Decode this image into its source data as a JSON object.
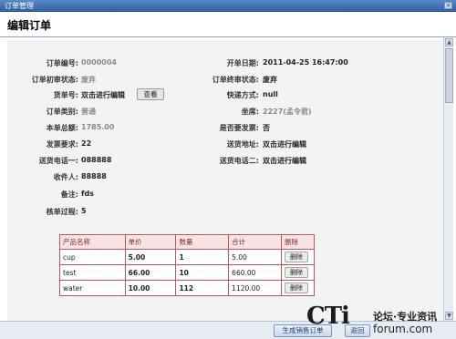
{
  "window": {
    "title": "订单管理",
    "close_glyph": "×"
  },
  "page": {
    "heading": "编辑订单"
  },
  "form": {
    "order_no_label": "订单编号:",
    "order_no": "0000004",
    "open_date_label": "开单日期:",
    "open_date": "2011-04-25 16:47:00",
    "initial_status_label": "订单初审状态:",
    "initial_status": "废弃",
    "final_status_label": "订单终审状态:",
    "final_status": "废弃",
    "goods_no_label": "货单号:",
    "goods_no": "双击进行编辑",
    "view_button": "查看",
    "express_label": "快递方式:",
    "express": "null",
    "order_type_label": "订单类别:",
    "order_type": "普通",
    "warehouse_label": "坐席:",
    "warehouse": "2227(孟令君)",
    "total_label": "本单总额:",
    "total": "1785.00",
    "invoice_needed_label": "是否要发票:",
    "invoice_needed": "否",
    "shipping_req_label": "发票要求:",
    "shipping_req": "22",
    "address_label": "送货地址:",
    "address": "双击进行编辑",
    "phone1_label": "送货电话一:",
    "phone1": "088888",
    "phone2_label": "送货电话二:",
    "phone2": "双击进行编辑",
    "receiver_label": "收件人:",
    "receiver": "88888",
    "remark_label": "备注:",
    "remark": "fds",
    "process_label": "核单过程:",
    "process": "5"
  },
  "items_table": {
    "headers": [
      "产品名称",
      "单价",
      "数量",
      "合计",
      "删除"
    ],
    "rows": [
      {
        "name": "cup",
        "price": "5.00",
        "qty": "1",
        "total": "5.00",
        "action": "删除"
      },
      {
        "name": "test",
        "price": "66.00",
        "qty": "10",
        "total": "660.00",
        "action": "删除"
      },
      {
        "name": "water",
        "price": "10.00",
        "qty": "112",
        "total": "1120.00",
        "action": "删除"
      }
    ]
  },
  "footer": {
    "generate_button": "生成销售订单",
    "back_button": "返回"
  },
  "watermark": {
    "brand": "CTi",
    "tagline": "论坛·专业资讯",
    "url": "forum.com"
  }
}
